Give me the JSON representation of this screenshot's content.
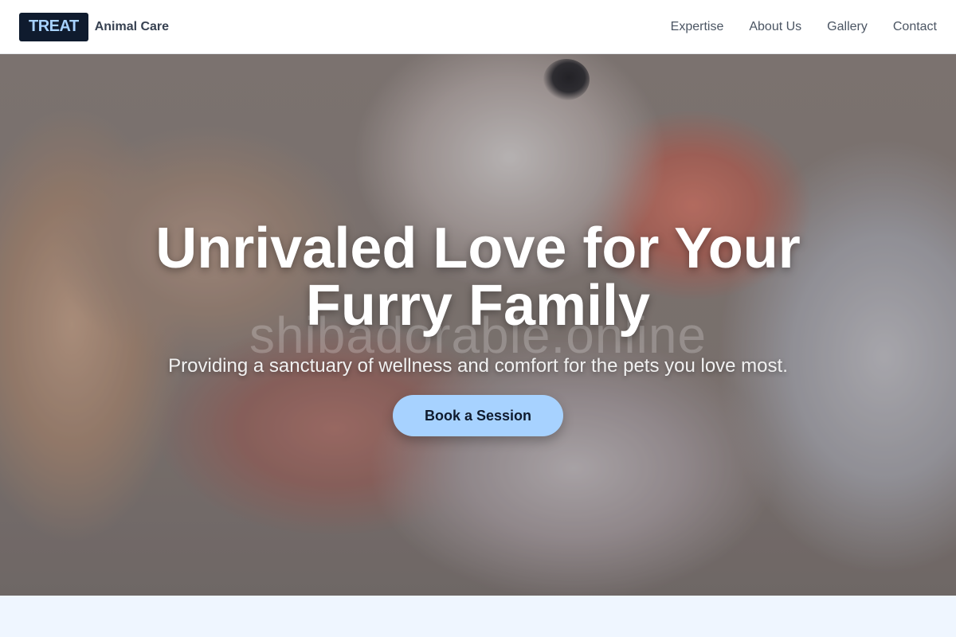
{
  "header": {
    "logo_badge": "TREAT",
    "logo_text": "Animal Care",
    "nav": [
      "Expertise",
      "About Us",
      "Gallery",
      "Contact"
    ]
  },
  "hero": {
    "title_line1": "Unrivaled Love for Your",
    "title_line2": "Furry Family",
    "subtitle": "Providing a sanctuary of wellness and comfort for the pets you love most.",
    "cta_label": "Book a Session",
    "watermark": "shibadorable.online"
  },
  "colors": {
    "brand_dark": "#0f1b2e",
    "accent": "#a7d2ff",
    "section_bg": "#eff6ff"
  }
}
